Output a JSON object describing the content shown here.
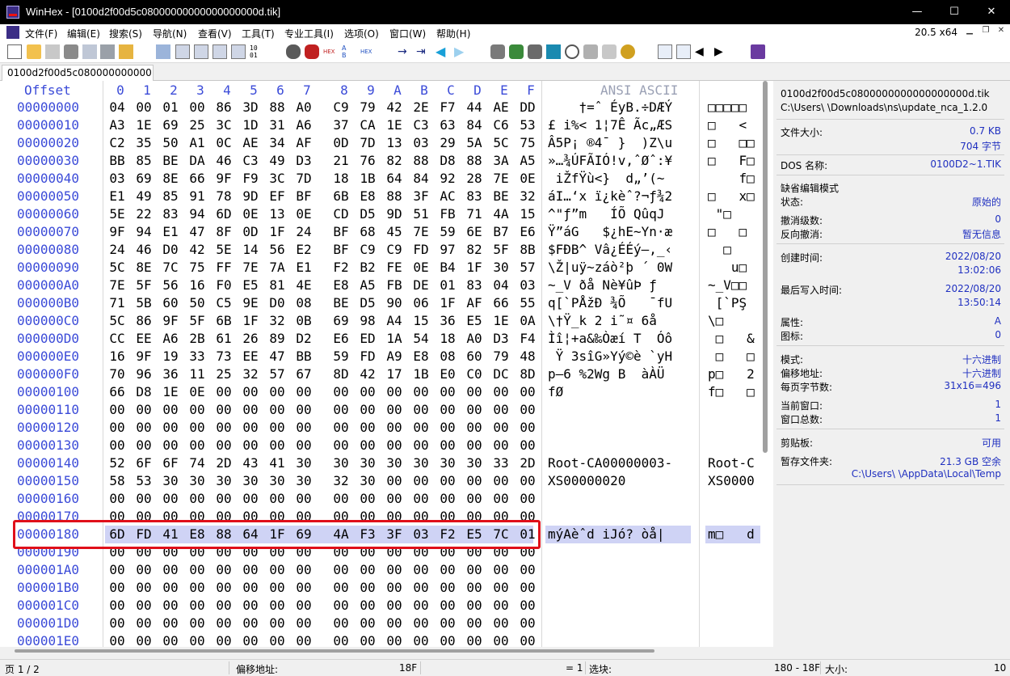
{
  "window": {
    "title": "WinHex - [0100d2f00d5c08000000000000000000d.tik]",
    "minimize": "—",
    "maximize": "☐",
    "close": "✕"
  },
  "menu": {
    "items": [
      "文件(F)",
      "编辑(E)",
      "搜索(S)",
      "导航(N)",
      "查看(V)",
      "工具(T)",
      "专业工具(I)",
      "选项(O)",
      "窗口(W)",
      "帮助(H)"
    ],
    "zoom": "20.5 x64"
  },
  "tab": {
    "label": "0100d2f00d5c080000000000..."
  },
  "editor": {
    "header_offset": "Offset",
    "columns": [
      "0",
      "1",
      "2",
      "3",
      "4",
      "5",
      "6",
      "7",
      "8",
      "9",
      "A",
      "B",
      "C",
      "D",
      "E",
      "F"
    ],
    "header_ansi": "ANSI ASCII",
    "rows": [
      {
        "off": "00000000",
        "bytes": [
          "04",
          "00",
          "01",
          "00",
          "86",
          "3D",
          "88",
          "A0",
          "C9",
          "79",
          "42",
          "2E",
          "F7",
          "44",
          "AE",
          "DD"
        ],
        "ansi": "    †=ˆ ÉyB.÷DÆÝ",
        "ascii": "□□□□□"
      },
      {
        "off": "00000010",
        "bytes": [
          "A3",
          "1E",
          "69",
          "25",
          "3C",
          "1D",
          "31",
          "A6",
          "37",
          "CA",
          "1E",
          "C3",
          "63",
          "84",
          "C6",
          "53"
        ],
        "ansi": "£ i%< 1¦7Ê Ãc„ÆS",
        "ascii": "□   <"
      },
      {
        "off": "00000020",
        "bytes": [
          "C2",
          "35",
          "50",
          "A1",
          "0C",
          "AE",
          "34",
          "AF",
          "0D",
          "7D",
          "13",
          "03",
          "29",
          "5A",
          "5C",
          "75"
        ],
        "ansi": "Â5P¡ ®4¯ }  )Z\\u",
        "ascii": "□   □□"
      },
      {
        "off": "00000030",
        "bytes": [
          "BB",
          "85",
          "BE",
          "DA",
          "46",
          "C3",
          "49",
          "D3",
          "21",
          "76",
          "82",
          "88",
          "D8",
          "88",
          "3A",
          "A5"
        ],
        "ansi": "»…¾ÚFÃIÓ!v‚ˆØˆ:¥",
        "ascii": "□   F□"
      },
      {
        "off": "00000040",
        "bytes": [
          "03",
          "69",
          "8E",
          "66",
          "9F",
          "F9",
          "3C",
          "7D",
          "18",
          "1B",
          "64",
          "84",
          "92",
          "28",
          "7E",
          "0E"
        ],
        "ansi": " iŽfŸù<}  d„’(~ ",
        "ascii": "    f□"
      },
      {
        "off": "00000050",
        "bytes": [
          "E1",
          "49",
          "85",
          "91",
          "78",
          "9D",
          "EF",
          "BF",
          "6B",
          "E8",
          "88",
          "3F",
          "AC",
          "83",
          "BE",
          "32"
        ],
        "ansi": "áI…‘x ï¿kèˆ?¬ƒ¾2",
        "ascii": "□   x□"
      },
      {
        "off": "00000060",
        "bytes": [
          "5E",
          "22",
          "83",
          "94",
          "6D",
          "0E",
          "13",
          "0E",
          "CD",
          "D5",
          "9D",
          "51",
          "FB",
          "71",
          "4A",
          "15"
        ],
        "ansi": "^\"ƒ”m   ÍÕ QûqJ ",
        "ascii": " \"□"
      },
      {
        "off": "00000070",
        "bytes": [
          "9F",
          "94",
          "E1",
          "47",
          "8F",
          "0D",
          "1F",
          "24",
          "BF",
          "68",
          "45",
          "7E",
          "59",
          "6E",
          "B7",
          "E6"
        ],
        "ansi": "Ÿ”áG   $¿hE~Yn·æ",
        "ascii": "□   □"
      },
      {
        "off": "00000080",
        "bytes": [
          "24",
          "46",
          "D0",
          "42",
          "5E",
          "14",
          "56",
          "E2",
          "BF",
          "C9",
          "C9",
          "FD",
          "97",
          "82",
          "5F",
          "8B"
        ],
        "ansi": "$FÐB^ Vâ¿ÉÉý—‚_‹",
        "ascii": "  □"
      },
      {
        "off": "00000090",
        "bytes": [
          "5C",
          "8E",
          "7C",
          "75",
          "FF",
          "7E",
          "7A",
          "E1",
          "F2",
          "B2",
          "FE",
          "0E",
          "B4",
          "1F",
          "30",
          "57"
        ],
        "ansi": "\\Ž|uÿ~záò²þ ´ 0W",
        "ascii": "   u□"
      },
      {
        "off": "000000A0",
        "bytes": [
          "7E",
          "5F",
          "56",
          "16",
          "F0",
          "E5",
          "81",
          "4E",
          "E8",
          "A5",
          "FB",
          "DE",
          "01",
          "83",
          "04",
          "03"
        ],
        "ansi": "~_V ðå Nè¥ûÞ ƒ  ",
        "ascii": "~_V□□"
      },
      {
        "off": "000000B0",
        "bytes": [
          "71",
          "5B",
          "60",
          "50",
          "C5",
          "9E",
          "D0",
          "08",
          "BE",
          "D5",
          "90",
          "06",
          "1F",
          "AF",
          "66",
          "55"
        ],
        "ansi": "q[`PÅžÐ ¾Õ   ¯fU",
        "ascii": " [`PŞ"
      },
      {
        "off": "000000C0",
        "bytes": [
          "5C",
          "86",
          "9F",
          "5F",
          "6B",
          "1F",
          "32",
          "0B",
          "69",
          "98",
          "A4",
          "15",
          "36",
          "E5",
          "1E",
          "0A"
        ],
        "ansi": "\\†Ÿ_k 2 i˜¤ 6å  ",
        "ascii": "\\□"
      },
      {
        "off": "000000D0",
        "bytes": [
          "CC",
          "EE",
          "A6",
          "2B",
          "61",
          "26",
          "89",
          "D2",
          "E6",
          "ED",
          "1A",
          "54",
          "18",
          "A0",
          "D3",
          "F4"
        ],
        "ansi": "Ìî¦+a&‰Òæí T  Óô",
        "ascii": " □   &"
      },
      {
        "off": "000000E0",
        "bytes": [
          "16",
          "9F",
          "19",
          "33",
          "73",
          "EE",
          "47",
          "BB",
          "59",
          "FD",
          "A9",
          "E8",
          "08",
          "60",
          "79",
          "48"
        ],
        "ansi": " Ÿ 3sîG»Yý©è `yH",
        "ascii": " □   □"
      },
      {
        "off": "000000F0",
        "bytes": [
          "70",
          "96",
          "36",
          "11",
          "25",
          "32",
          "57",
          "67",
          "8D",
          "42",
          "17",
          "1B",
          "E0",
          "C0",
          "DC",
          "8D"
        ],
        "ansi": "p–6 %2Wg B  àÀÜ ",
        "ascii": "p□   2"
      },
      {
        "off": "00000100",
        "bytes": [
          "66",
          "D8",
          "1E",
          "0E",
          "00",
          "00",
          "00",
          "00",
          "00",
          "00",
          "00",
          "00",
          "00",
          "00",
          "00",
          "00"
        ],
        "ansi": "fØ",
        "ascii": "f□   □"
      },
      {
        "off": "00000110",
        "bytes": [
          "00",
          "00",
          "00",
          "00",
          "00",
          "00",
          "00",
          "00",
          "00",
          "00",
          "00",
          "00",
          "00",
          "00",
          "00",
          "00"
        ],
        "ansi": "",
        "ascii": ""
      },
      {
        "off": "00000120",
        "bytes": [
          "00",
          "00",
          "00",
          "00",
          "00",
          "00",
          "00",
          "00",
          "00",
          "00",
          "00",
          "00",
          "00",
          "00",
          "00",
          "00"
        ],
        "ansi": "",
        "ascii": ""
      },
      {
        "off": "00000130",
        "bytes": [
          "00",
          "00",
          "00",
          "00",
          "00",
          "00",
          "00",
          "00",
          "00",
          "00",
          "00",
          "00",
          "00",
          "00",
          "00",
          "00"
        ],
        "ansi": "",
        "ascii": ""
      },
      {
        "off": "00000140",
        "bytes": [
          "52",
          "6F",
          "6F",
          "74",
          "2D",
          "43",
          "41",
          "30",
          "30",
          "30",
          "30",
          "30",
          "30",
          "30",
          "33",
          "2D"
        ],
        "ansi": "Root-CA00000003-",
        "ascii": "Root-C"
      },
      {
        "off": "00000150",
        "bytes": [
          "58",
          "53",
          "30",
          "30",
          "30",
          "30",
          "30",
          "30",
          "32",
          "30",
          "00",
          "00",
          "00",
          "00",
          "00",
          "00"
        ],
        "ansi": "XS00000020",
        "ascii": "XS0000"
      },
      {
        "off": "00000160",
        "bytes": [
          "00",
          "00",
          "00",
          "00",
          "00",
          "00",
          "00",
          "00",
          "00",
          "00",
          "00",
          "00",
          "00",
          "00",
          "00",
          "00"
        ],
        "ansi": "",
        "ascii": ""
      },
      {
        "off": "00000170",
        "bytes": [
          "00",
          "00",
          "00",
          "00",
          "00",
          "00",
          "00",
          "00",
          "00",
          "00",
          "00",
          "00",
          "00",
          "00",
          "00",
          "00"
        ],
        "ansi": "",
        "ascii": ""
      },
      {
        "off": "00000180",
        "bytes": [
          "6D",
          "FD",
          "41",
          "E8",
          "88",
          "64",
          "1F",
          "69",
          "4A",
          "F3",
          "3F",
          "03",
          "F2",
          "E5",
          "7C",
          "01"
        ],
        "ansi": "mýAèˆd iJó? òå|",
        "ascii": "m□   d"
      },
      {
        "off": "00000190",
        "bytes": [
          "00",
          "00",
          "00",
          "00",
          "00",
          "00",
          "00",
          "00",
          "00",
          "00",
          "00",
          "00",
          "00",
          "00",
          "00",
          "00"
        ],
        "ansi": "",
        "ascii": ""
      },
      {
        "off": "000001A0",
        "bytes": [
          "00",
          "00",
          "00",
          "00",
          "00",
          "00",
          "00",
          "00",
          "00",
          "00",
          "00",
          "00",
          "00",
          "00",
          "00",
          "00"
        ],
        "ansi": "",
        "ascii": ""
      },
      {
        "off": "000001B0",
        "bytes": [
          "00",
          "00",
          "00",
          "00",
          "00",
          "00",
          "00",
          "00",
          "00",
          "00",
          "00",
          "00",
          "00",
          "00",
          "00",
          "00"
        ],
        "ansi": "",
        "ascii": ""
      },
      {
        "off": "000001C0",
        "bytes": [
          "00",
          "00",
          "00",
          "00",
          "00",
          "00",
          "00",
          "00",
          "00",
          "00",
          "00",
          "00",
          "00",
          "00",
          "00",
          "00"
        ],
        "ansi": "",
        "ascii": ""
      },
      {
        "off": "000001D0",
        "bytes": [
          "00",
          "00",
          "00",
          "00",
          "00",
          "00",
          "00",
          "00",
          "00",
          "00",
          "00",
          "00",
          "00",
          "00",
          "00",
          "00"
        ],
        "ansi": "",
        "ascii": ""
      },
      {
        "off": "000001E0",
        "bytes": [
          "00",
          "00",
          "00",
          "00",
          "00",
          "00",
          "00",
          "00",
          "00",
          "00",
          "00",
          "00",
          "00",
          "00",
          "00",
          "00"
        ],
        "ansi": "",
        "ascii": ""
      }
    ]
  },
  "info": {
    "filename": "0100d2f00d5c0800000000000000000d.tik",
    "path": "C:\\Users\\        \\Downloads\\ns\\update_nca_1.2.0",
    "size_label": "文件大小:",
    "size_kb": "0.7 KB",
    "size_bytes": "704 字节",
    "dos_label": "DOS 名称:",
    "dos_value": "0100D2~1.TIK",
    "mode_title": "缺省编辑模式",
    "state_label": "状态:",
    "state_value": "原始的",
    "undo_label": "撤消级数:",
    "undo_value": "0",
    "redo_label": "反向撤消:",
    "redo_value": "暂无信息",
    "created_label": "创建时间:",
    "created_date": "2022/08/20",
    "created_time": "13:02:06",
    "modified_label": "最后写入时间:",
    "modified_date": "2022/08/20",
    "modified_time": "13:50:14",
    "attr_label": "属性:",
    "attr_value": "A",
    "icon_label": "图标:",
    "icon_value": "0",
    "mode_label": "模式:",
    "mode_value": "十六进制",
    "offset_label": "偏移地址:",
    "offset_value": "十六进制",
    "bpp_label": "每页字节数:",
    "bpp_value": "31x16=496",
    "curwin_label": "当前窗口:",
    "curwin_value": "1",
    "totwin_label": "窗口总数:",
    "totwin_value": "1",
    "clip_label": "剪贴板:",
    "clip_value": "可用",
    "temp_label": "暂存文件夹:",
    "temp_free": "21.3 GB 空余",
    "temp_path": "C:\\Users\\          \\AppData\\Local\\Temp"
  },
  "status": {
    "page": "页 1 / 2",
    "offset_label": "偏移地址:",
    "offset_value": "18F",
    "eq": "= 1",
    "sel_label": "选块:",
    "sel_range": "180 - 18F",
    "size_label": "大小:",
    "size_value": "10"
  }
}
